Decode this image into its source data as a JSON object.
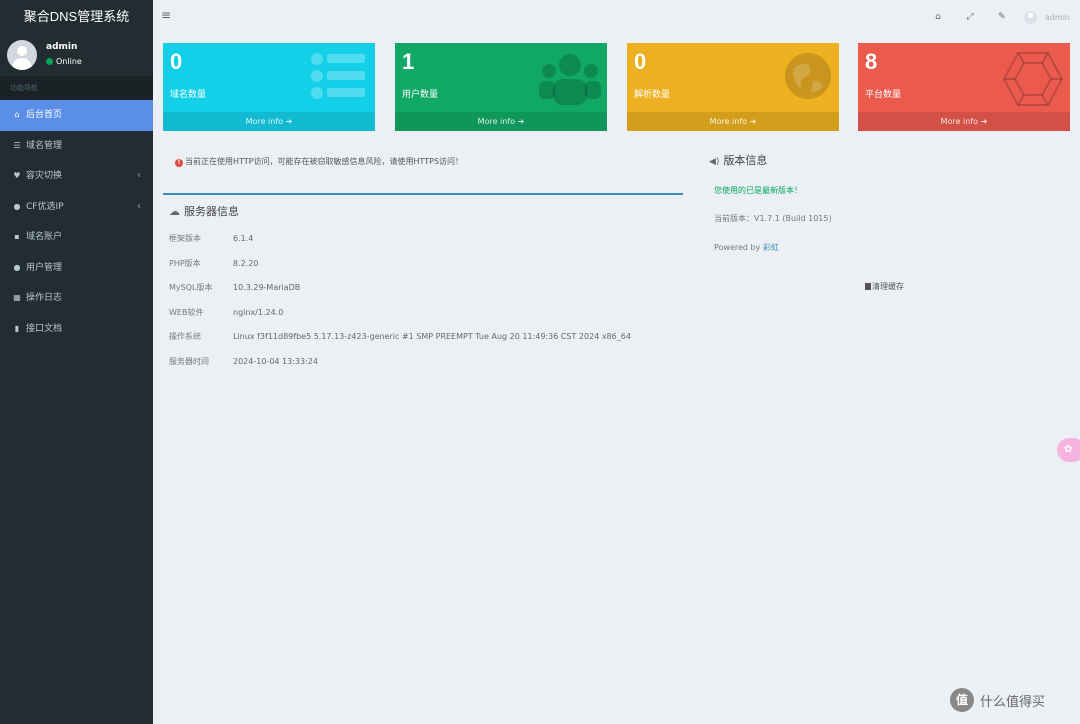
{
  "app": {
    "title": "聚合DNS管理系统"
  },
  "user": {
    "name": "admin",
    "status": "Online"
  },
  "sidebar": {
    "header": "功能导航",
    "items": [
      {
        "label": "后台首页",
        "icon": "home-icon",
        "active": true,
        "has_children": false
      },
      {
        "label": "域名管理",
        "icon": "list-icon",
        "active": false,
        "has_children": false
      },
      {
        "label": "容灾切换",
        "icon": "heartbeat-icon",
        "active": false,
        "has_children": true
      },
      {
        "label": "CF优选IP",
        "icon": "globe-icon",
        "active": false,
        "has_children": true
      },
      {
        "label": "域名账户",
        "icon": "lock-icon",
        "active": false,
        "has_children": false
      },
      {
        "label": "用户管理",
        "icon": "user-icon",
        "active": false,
        "has_children": false
      },
      {
        "label": "操作日志",
        "icon": "table-icon",
        "active": false,
        "has_children": false
      },
      {
        "label": "接口文档",
        "icon": "book-icon",
        "active": false,
        "has_children": false
      }
    ]
  },
  "topbar": {
    "menu_icon": "hamburger-icon",
    "user_label": "admin"
  },
  "stats": [
    {
      "value": "0",
      "label": "域名数量",
      "more": "More info",
      "color": "#13d0e8",
      "icon": "list-icon"
    },
    {
      "value": "1",
      "label": "用户数量",
      "more": "More info",
      "color": "#11a865",
      "icon": "users-icon"
    },
    {
      "value": "0",
      "label": "解析数量",
      "more": "More info",
      "color": "#edb021",
      "icon": "globe-icon"
    },
    {
      "value": "8",
      "label": "平台数量",
      "more": "More info",
      "color": "#ea5a4d",
      "icon": "hexagon-icon"
    }
  ],
  "alert": "当前正在使用HTTP访问，可能存在被窃取敏感信息风险，请使用HTTPS访问！",
  "server": {
    "title": "服务器信息",
    "rows": [
      {
        "key": "框架版本",
        "value": "6.1.4"
      },
      {
        "key": "PHP版本",
        "value": "8.2.20"
      },
      {
        "key": "MySQL版本",
        "value": "10.3.29-MariaDB"
      },
      {
        "key": "WEB软件",
        "value": "nginx/1.24.0"
      },
      {
        "key": "操作系统",
        "value": "Linux f3f11d89fbe5 5.17.13-z423-generic #1 SMP PREEMPT Tue Aug 20 11:49:36 CST 2024 x86_64"
      },
      {
        "key": "服务器时间",
        "value": "2024-10-04 13:33:24"
      }
    ]
  },
  "version": {
    "title": "版本信息",
    "latest": "您使用的已是最新版本！",
    "current": "当前版本：V1.7.1 (Build 1015)",
    "powered_prefix": "Powered by",
    "powered_link": "彩虹",
    "clear_cache": "清理缓存"
  },
  "watermark": {
    "logo_text": "值",
    "text": "什么值得买"
  }
}
